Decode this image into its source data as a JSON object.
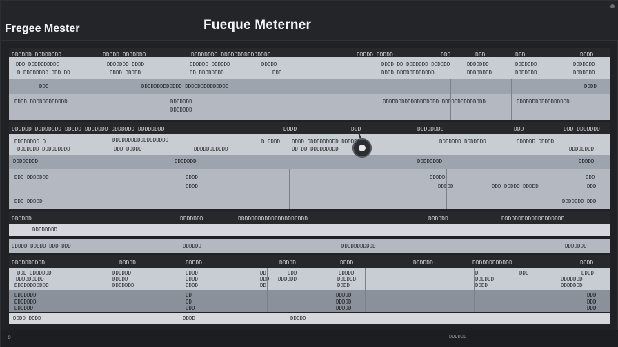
{
  "app": {
    "name": "Fregee Mester",
    "window_title": "Fueque Meterner"
  },
  "sections": [
    {
      "header": [
        "DDDDDD DDDDDDDD",
        "DDDDD DDDDDDD",
        "DDDDDDDD DDDDDDDDDDDDDDD",
        "DDDDD DDDDD",
        "DDD",
        "DDD",
        "DDD",
        "DDDD"
      ]
    },
    {
      "header": [
        "DDDDDD DDDDDDDD DDDDD DDDDDDD DDDDDDD DDDDDDDD",
        "DDDD",
        "DDD",
        "DDDDDDDD",
        "DDD",
        "DDD DDDDDDD"
      ]
    },
    {
      "header": [
        "DDDDDD",
        "DDDDDDD",
        "DDDDDDDDDDDDDDDDDDDDD",
        "DDDDDD",
        "DDDDDDDDDDDDDDDDDDD"
      ]
    },
    {
      "header": [
        "DDDDDDDDDD",
        "DDDDD",
        "DDDDD",
        "DDDDD",
        "DDDD",
        "DDDDDD",
        "DDDDDDDDDDDD",
        "DDDD"
      ]
    }
  ],
  "rows": {
    "r1": [
      "DDD DDDDDDDDDD",
      "DDDDDDD DDDD",
      "DDDDDD DDDDDD",
      "DDDDD",
      "DDDD DD DDDDDDD DDDDDD",
      "DDDDDDD",
      "DDDDDDD",
      "DDDDDDD"
    ],
    "r2": [
      "D DDDDDDDD DDD DD",
      "DDDD DDDDD",
      "DD DDDDDDDD",
      "DDD",
      "DDDD DDDDDDDDDDDD",
      "DDDDDDDD",
      "DDDDDDD",
      "DDDDDDD"
    ],
    "r3": [
      "DDD",
      "DDDDDDDDDDDDD DDDDDDDDDDDDDD",
      "DDDD"
    ],
    "r4": [
      "DDDD DDDDDDDDDDDD",
      "DDDDDDD",
      "DDDDDDDDDDDDDDDDDD DDDDDDDDDDDDDD",
      "DDDDDDDDDDDDDDDDD"
    ],
    "r5": [
      "DDDDDDD"
    ],
    "r6": [
      "DDDDDDDD D",
      "DDDDDDDDDDDDDDDDDD",
      "D DDDD",
      "DDDD DDDDDDDDDD DDDDDD",
      "DDDDDDD DDDDDDD",
      "DDDDDD DDDDD"
    ],
    "r7": [
      "DDDDDDD DDDDDDDDD",
      "DDD DDDDD",
      "DDDDDDDDDDD",
      "DD DD DDDDDDDDD",
      "DDDDDDDD"
    ],
    "r8": [
      "DDDDDDDD",
      "DDDDDDD",
      "DDDDDDDD",
      "DDDDD"
    ],
    "r9": [
      "DDD DDDDDDD",
      "DDDD",
      "DDDDD",
      "DDD"
    ],
    "r10": [
      "DDDD",
      "DDDDD",
      "DDD DDDDD DDDDD",
      "DDD"
    ],
    "r11": [
      "DDD DDDDD",
      "DDDDDDD",
      "DDD"
    ],
    "r12": [
      "DDDDDDDD"
    ],
    "r13": [
      "DDDDD DDDDD DDD DDD",
      "DDDDDD",
      "DDDDDDDDDDD",
      "DDDDDDD"
    ],
    "r14": [
      "DDD DDDDDDD",
      "DDDDDD",
      "DDDD",
      "DD",
      "DDD",
      "DDDDD",
      "D",
      "DDD",
      "DDDD"
    ],
    "r15": [
      "DDDDDDDDD",
      "DDDDD",
      "DDDD",
      "DDD",
      "DDDDDD",
      "DDDDDD",
      "DDDDDD",
      "DDDDDDD"
    ],
    "r16": [
      "DDDDDDDDDDD",
      "DDDDDDD",
      "DDDD",
      "DD",
      "DDDD",
      "DDDD",
      "DDDDDDD"
    ],
    "r17": [
      "DDDDDDD",
      "DD",
      "DDDDD",
      "DDD"
    ],
    "r18": [
      "DDDDDDD",
      "DD",
      "DDDDD",
      "DDD"
    ],
    "r19": [
      "DDDDDD",
      "DDD",
      "DDDDD",
      "DDD"
    ],
    "r20": [
      "DDDD DDDD",
      "DDDD",
      "DDDDD"
    ]
  },
  "status": {
    "left": "o",
    "right": "DDDDDD"
  }
}
